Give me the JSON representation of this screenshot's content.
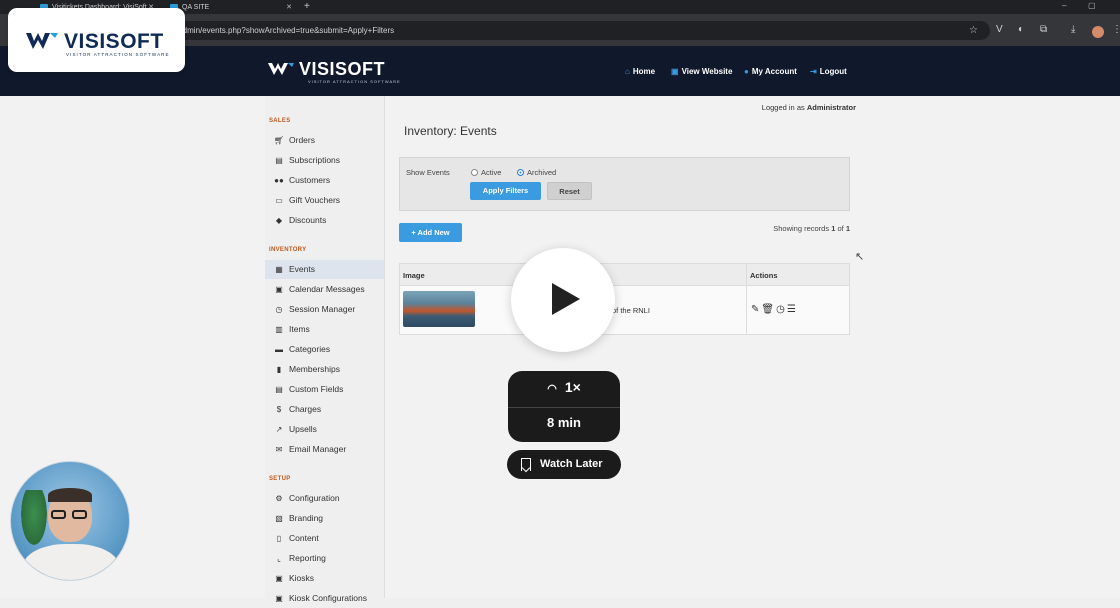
{
  "browser": {
    "tabs": [
      {
        "title": "Visitickets Dashboard: VisiSoft"
      },
      {
        "title": "QA SITE"
      }
    ],
    "url": "k/admin/events.php?showArchived=true&submit=Apply+Filters"
  },
  "header": {
    "logo": "VISISOFT",
    "tagline": "VISITOR ATTRACTION SOFTWARE",
    "nav": [
      {
        "label": "Home",
        "icon": "home-icon"
      },
      {
        "label": "View Website",
        "icon": "external-link-icon"
      },
      {
        "label": "My Account",
        "icon": "user-icon"
      },
      {
        "label": "Logout",
        "icon": "logout-icon"
      }
    ]
  },
  "sidebar": {
    "sections": [
      {
        "title": "SALES",
        "items": [
          {
            "label": "Orders",
            "icon": "cart-icon"
          },
          {
            "label": "Subscriptions",
            "icon": "subscription-icon"
          },
          {
            "label": "Customers",
            "icon": "users-icon"
          },
          {
            "label": "Gift Vouchers",
            "icon": "voucher-icon"
          },
          {
            "label": "Discounts",
            "icon": "tag-icon"
          }
        ]
      },
      {
        "title": "INVENTORY",
        "items": [
          {
            "label": "Events",
            "icon": "calendar-icon",
            "active": true
          },
          {
            "label": "Calendar Messages",
            "icon": "calendar-message-icon"
          },
          {
            "label": "Session Manager",
            "icon": "clock-icon"
          },
          {
            "label": "Items",
            "icon": "items-icon"
          },
          {
            "label": "Categories",
            "icon": "folder-icon"
          },
          {
            "label": "Memberships",
            "icon": "membership-icon"
          },
          {
            "label": "Custom Fields",
            "icon": "fields-icon"
          },
          {
            "label": "Charges",
            "icon": "dollar-icon"
          },
          {
            "label": "Upsells",
            "icon": "upsell-icon"
          },
          {
            "label": "Email Manager",
            "icon": "email-icon"
          }
        ]
      },
      {
        "title": "SETUP",
        "items": [
          {
            "label": "Configuration",
            "icon": "gear-icon"
          },
          {
            "label": "Branding",
            "icon": "branding-icon"
          },
          {
            "label": "Content",
            "icon": "content-icon"
          },
          {
            "label": "Reporting",
            "icon": "chart-icon"
          },
          {
            "label": "Kiosks",
            "icon": "kiosk-icon"
          },
          {
            "label": "Kiosk Configurations",
            "icon": "kiosk-config-icon"
          }
        ]
      }
    ]
  },
  "main": {
    "logged_in_prefix": "Logged in as",
    "logged_in_user": "Administrator",
    "title": "Inventory: Events",
    "filters": {
      "label": "Show Events",
      "options": [
        {
          "label": "Active",
          "selected": false
        },
        {
          "label": "Archived",
          "selected": true
        }
      ],
      "apply_label": "Apply Filters",
      "reset_label": "Reset"
    },
    "add_new_label": "+ Add New",
    "showing": {
      "prefix": "Showing records",
      "from": "1",
      "of_word": "of",
      "total": "1"
    },
    "table": {
      "columns": [
        "Image",
        "Actions"
      ],
      "rows": [
        {
          "text_visible": "of the RNLI",
          "image": "lifeboat-photo"
        }
      ],
      "action_icons": [
        "edit-icon",
        "trash-icon",
        "clock-icon",
        "list-icon"
      ]
    }
  },
  "overlay": {
    "brand_logo": "VISISOFT",
    "brand_tagline": "VISITOR ATTRACTION SOFTWARE",
    "speed": "1×",
    "duration": "8 min",
    "watch_later": "Watch Later"
  },
  "colors": {
    "header_bg": "#10182b",
    "accent": "#3a9be0",
    "section_title": "#c05a1e",
    "overlay_dark": "#1b1b1b"
  }
}
